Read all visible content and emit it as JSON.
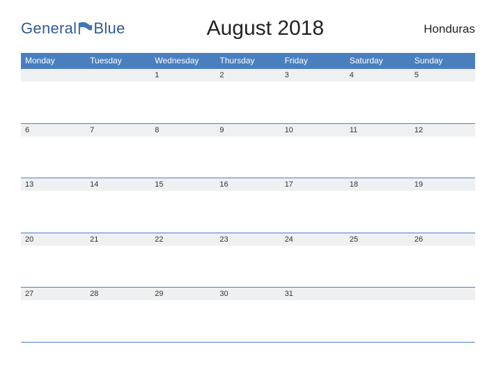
{
  "logo": {
    "word1": "General",
    "word2": "Blue"
  },
  "title": "August 2018",
  "region": "Honduras",
  "days": [
    "Monday",
    "Tuesday",
    "Wednesday",
    "Thursday",
    "Friday",
    "Saturday",
    "Sunday"
  ],
  "weeks": [
    [
      "",
      "",
      "1",
      "2",
      "3",
      "4",
      "5"
    ],
    [
      "6",
      "7",
      "8",
      "9",
      "10",
      "11",
      "12"
    ],
    [
      "13",
      "14",
      "15",
      "16",
      "17",
      "18",
      "19"
    ],
    [
      "20",
      "21",
      "22",
      "23",
      "24",
      "25",
      "26"
    ],
    [
      "27",
      "28",
      "29",
      "30",
      "31",
      "",
      ""
    ]
  ]
}
